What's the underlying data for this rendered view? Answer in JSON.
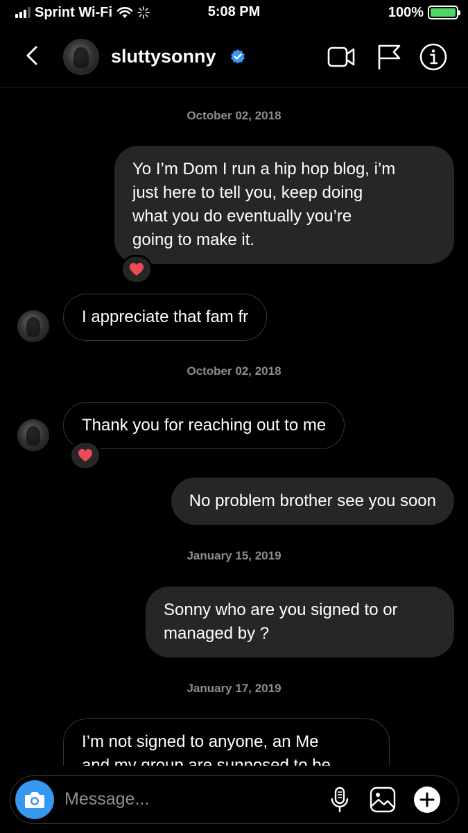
{
  "status_bar": {
    "carrier": "Sprint Wi-Fi",
    "time": "5:08 PM",
    "battery_percent": "100%",
    "battery_level": 1.0,
    "icons": [
      "signal-icon",
      "wifi-icon",
      "loading-spinner-icon",
      "battery-charging-icon"
    ]
  },
  "header": {
    "username": "sluttysonny",
    "verified": true,
    "icons": [
      "back-chevron-icon",
      "video-call-icon",
      "flag-icon",
      "info-icon"
    ]
  },
  "colors": {
    "background": "#000000",
    "outgoing_bubble": "#262626",
    "incoming_border": "#363636",
    "date_text": "#8e8e8e",
    "verified_badge": "#3797f0",
    "camera_button": "#3797f0",
    "heart": "#ed4956",
    "battery_fill": "#4cd964"
  },
  "messages": {
    "date1": "October 02, 2018",
    "msg1": {
      "direction": "outgoing",
      "lines": [
        "Yo I’m Dom I run a hip hop blog, i’m",
        "just here to tell you, keep doing",
        "what you do eventually you’re",
        "going to make it."
      ],
      "reaction": "heart-reaction-icon"
    },
    "msg2": {
      "direction": "incoming",
      "text": "I appreciate that fam fr"
    },
    "date2": "October 02, 2018",
    "msg3": {
      "direction": "incoming",
      "text": "Thank you for reaching out to me",
      "reaction": "heart-reaction-icon"
    },
    "msg4": {
      "direction": "outgoing",
      "text": "No problem brother see you soon"
    },
    "date3": "January 15, 2019",
    "msg5": {
      "direction": "outgoing",
      "lines": [
        "Sonny who are you signed to or",
        "managed by ?"
      ]
    },
    "date4": "January 17, 2019",
    "msg6": {
      "direction": "incoming",
      "lines": [
        "I’m not signed to anyone, an Me",
        "and my group are supposed to be"
      ]
    }
  },
  "composer": {
    "placeholder": "Message...",
    "icons": [
      "camera-icon",
      "microphone-icon",
      "gallery-icon",
      "plus-icon"
    ]
  }
}
